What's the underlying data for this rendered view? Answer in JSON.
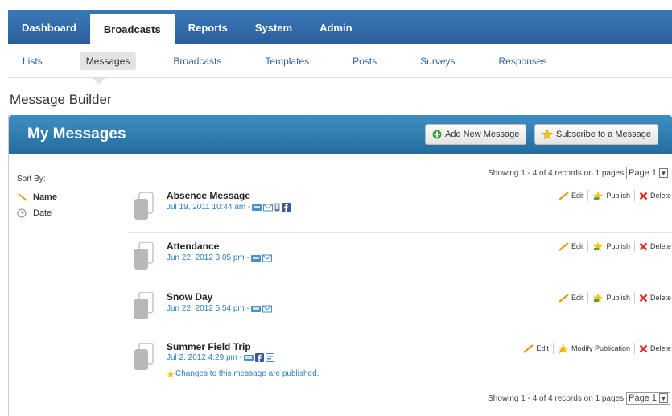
{
  "nav": {
    "tabs": [
      {
        "label": "Dashboard"
      },
      {
        "label": "Broadcasts"
      },
      {
        "label": "Reports"
      },
      {
        "label": "System"
      },
      {
        "label": "Admin"
      }
    ]
  },
  "subnav": {
    "items": [
      {
        "label": "Lists"
      },
      {
        "label": "Messages"
      },
      {
        "label": "Broadcasts"
      },
      {
        "label": "Templates"
      },
      {
        "label": "Posts"
      },
      {
        "label": "Surveys"
      },
      {
        "label": "Responses"
      }
    ]
  },
  "page": {
    "title": "Message Builder"
  },
  "panel": {
    "title": "My Messages",
    "add_label": "Add New Message",
    "subscribe_label": "Subscribe to a Message"
  },
  "sort": {
    "label": "Sort By:",
    "name_label": "Name",
    "date_label": "Date"
  },
  "pager": {
    "showing_text": "Showing 1 - 4 of 4 records on 1 pages",
    "page_value": "Page 1"
  },
  "actions": {
    "edit": "Edit",
    "publish": "Publish",
    "modify_publication": "Modify Publication",
    "delete": "Delete"
  },
  "messages": [
    {
      "name": "Absence Message",
      "date": "Jul 19, 2011 10:44 am -"
    },
    {
      "name": "Attendance",
      "date": "Jun 22, 2012 3:05 pm -"
    },
    {
      "name": "Snow Day",
      "date": "Jun 22, 2012 5:54 pm -"
    },
    {
      "name": "Summer Field Trip",
      "date": "Jul 2, 2012 4:29 pm -",
      "note": "Changes to this message are published."
    }
  ],
  "colors": {
    "nav_blue": "#2f6aa8",
    "panel_blue": "#2f7db0",
    "link_blue": "#2a7fc0",
    "delete_red": "#d9322d"
  }
}
